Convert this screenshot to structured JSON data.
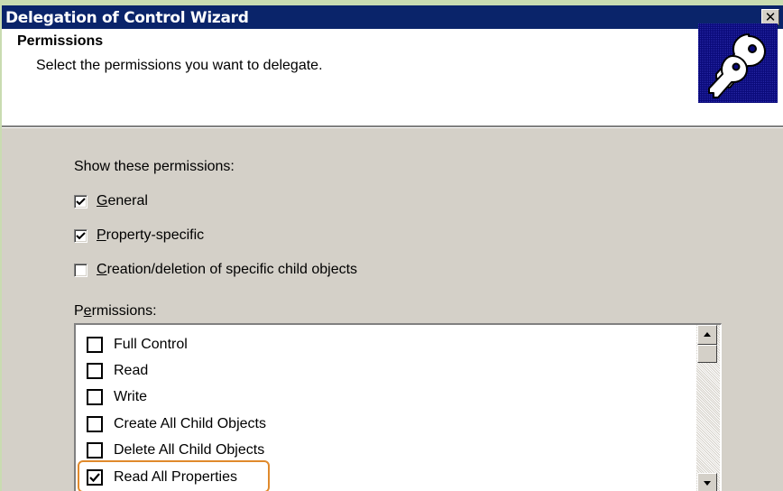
{
  "window": {
    "title": "Delegation of Control Wizard",
    "close_glyph": "✕"
  },
  "header": {
    "title": "Permissions",
    "subtitle": "Select the permissions you want to delegate.",
    "icon": "keys-icon"
  },
  "show_permissions": {
    "label": "Show these permissions:",
    "options": [
      {
        "mnemonic": "G",
        "rest": "eneral",
        "checked": true
      },
      {
        "mnemonic": "P",
        "rest": "roperty-specific",
        "checked": true
      },
      {
        "mnemonic": "C",
        "rest": "reation/deletion of specific child objects",
        "checked": false
      }
    ]
  },
  "permissions_list": {
    "label_pre": "P",
    "label_mnemonic": "e",
    "label_post": "rmissions:",
    "items": [
      {
        "label": "Full Control",
        "checked": false
      },
      {
        "label": "Read",
        "checked": false
      },
      {
        "label": "Write",
        "checked": false
      },
      {
        "label": "Create All Child Objects",
        "checked": false
      },
      {
        "label": "Delete All Child Objects",
        "checked": false
      },
      {
        "label": "Read All Properties",
        "checked": true
      }
    ],
    "highlighted_item": "Read All Properties"
  },
  "colors": {
    "titlebar": "#0a246a",
    "dialog_bg": "#d4d0c8",
    "highlight_outline": "#e08a2c",
    "page_bg": "#c9dcb1"
  }
}
